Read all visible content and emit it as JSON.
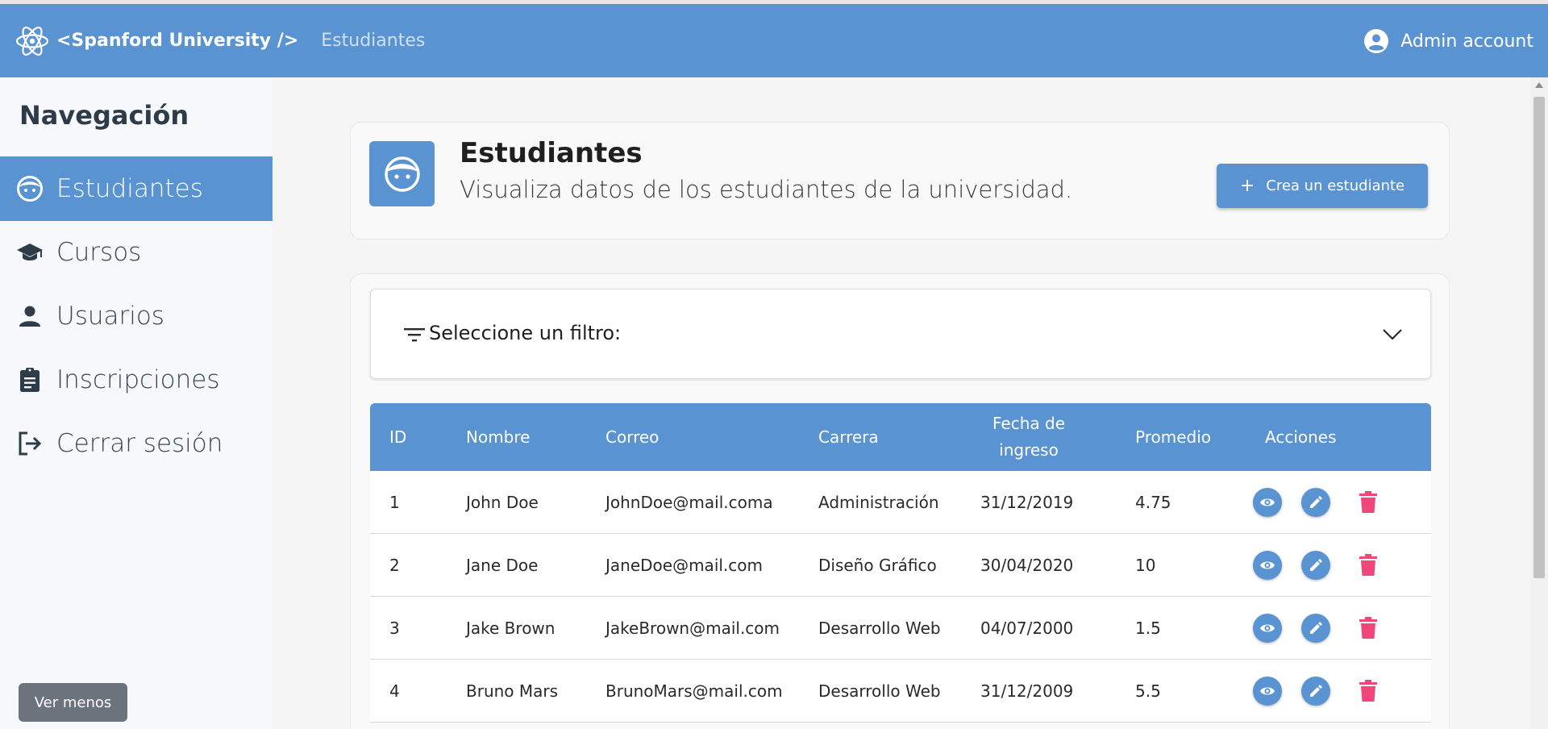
{
  "header": {
    "brand": "<Spanford University />",
    "breadcrumb": "Estudiantes",
    "account": "Admin account"
  },
  "sidebar": {
    "title": "Navegación",
    "items": [
      {
        "label": "Estudiantes",
        "icon": "face-icon",
        "active": true
      },
      {
        "label": "Cursos",
        "icon": "graduation-cap-icon",
        "active": false
      },
      {
        "label": "Usuarios",
        "icon": "person-icon",
        "active": false
      },
      {
        "label": "Inscripciones",
        "icon": "clipboard-icon",
        "active": false
      },
      {
        "label": "Cerrar sesión",
        "icon": "logout-icon",
        "active": false
      }
    ],
    "collapse_label": "Ver menos"
  },
  "page": {
    "title": "Estudiantes",
    "subtitle": "Visualiza datos de los estudiantes de la universidad.",
    "create_label": "Crea un estudiante",
    "create_icon": "plus-icon"
  },
  "filter": {
    "label": "Seleccione un filtro:"
  },
  "table": {
    "headers": [
      "ID",
      "Nombre",
      "Correo",
      "Carrera",
      "Fecha de ingreso",
      "Promedio",
      "Acciones"
    ],
    "header_fecha_line1": "Fecha de",
    "header_fecha_line2": "ingreso",
    "rows": [
      {
        "id": "1",
        "nombre": "John Doe",
        "correo": "JohnDoe@mail.coma",
        "carrera": "Administración",
        "fecha": "31/12/2019",
        "promedio": "4.75"
      },
      {
        "id": "2",
        "nombre": "Jane Doe",
        "correo": "JaneDoe@mail.com",
        "carrera": "Diseño Gráfico",
        "fecha": "30/04/2020",
        "promedio": "10"
      },
      {
        "id": "3",
        "nombre": "Jake Brown",
        "correo": "JakeBrown@mail.com",
        "carrera": "Desarrollo Web",
        "fecha": "04/07/2000",
        "promedio": "1.5"
      },
      {
        "id": "4",
        "nombre": "Bruno Mars",
        "correo": "BrunoMars@mail.com",
        "carrera": "Desarrollo Web",
        "fecha": "31/12/2009",
        "promedio": "5.5"
      }
    ]
  },
  "colors": {
    "primary": "#5a93d2",
    "danger": "#f0467a",
    "sidebar_bg": "#f7f8fb"
  }
}
